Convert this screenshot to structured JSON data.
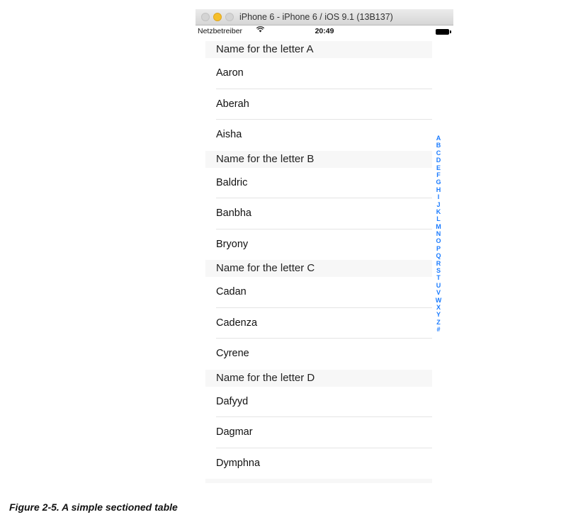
{
  "window": {
    "title": "iPhone 6 - iPhone 6 / iOS 9.1 (13B137)"
  },
  "statusbar": {
    "carrier": "Netzbetreiber",
    "wifi_icon": "wifi-icon",
    "time": "20:49",
    "battery_icon": "battery-icon"
  },
  "sections": [
    {
      "header": "Name for the letter A",
      "rows": [
        "Aaron",
        "Aberah",
        "Aisha"
      ]
    },
    {
      "header": "Name for the letter B",
      "rows": [
        "Baldric",
        "Banbha",
        "Bryony"
      ]
    },
    {
      "header": "Name for the letter C",
      "rows": [
        "Cadan",
        "Cadenza",
        "Cyrene"
      ]
    },
    {
      "header": "Name for the letter D",
      "rows": [
        "Dafyyd",
        "Dagmar",
        "Dymphna"
      ]
    }
  ],
  "index": [
    "A",
    "B",
    "C",
    "D",
    "E",
    "F",
    "G",
    "H",
    "I",
    "J",
    "K",
    "L",
    "M",
    "N",
    "O",
    "P",
    "Q",
    "R",
    "S",
    "T",
    "U",
    "V",
    "W",
    "X",
    "Y",
    "Z",
    "#"
  ],
  "caption": "Figure 2-5. A simple sectioned table",
  "colors": {
    "accent": "#1a7bff",
    "header_bg": "#f7f7f7",
    "separator": "#e4e4e4"
  }
}
